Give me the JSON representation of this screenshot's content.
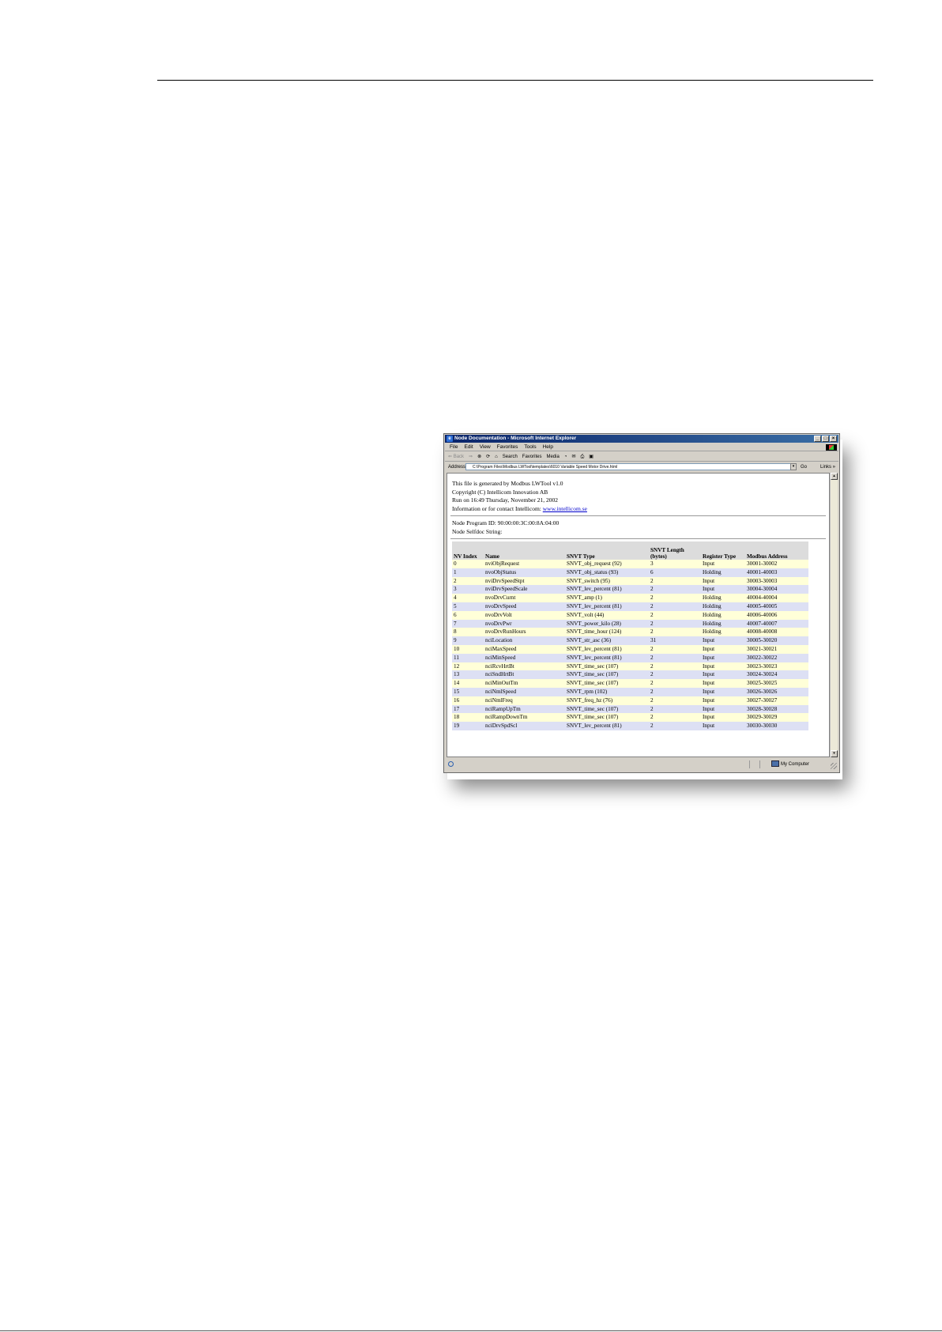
{
  "window": {
    "title": "Node Documentation - Microsoft Internet Explorer",
    "controls": [
      "_",
      "□",
      "×"
    ]
  },
  "menu": [
    "File",
    "Edit",
    "View",
    "Favorites",
    "Tools",
    "Help"
  ],
  "toolbar": {
    "back": "⇐ Back",
    "forward": "⇒",
    "stop": "⊗",
    "refresh": "⟳",
    "home": "⌂",
    "search": "Search",
    "favorites": "Favorites",
    "media": "Media",
    "history": "◔",
    "mail": "✉",
    "print": "⎙",
    "edit": "▣"
  },
  "address": {
    "label": "Address",
    "value": "C:\\Program Files\\Modbus LWTool\\templates\\6010 Variable Speed Motor Drive.html",
    "go": "Go",
    "links": "Links »"
  },
  "info": {
    "line1": "This file is generated by Modbus LWTool v1.0",
    "line2": "Copyright (C) Intellicom Innovation AB",
    "line3": "Run on 16:49 Thursday, November 21, 2002",
    "line4_prefix": "Information or for contact Intellicom: ",
    "link": "www.intellicom.se"
  },
  "node": {
    "program_id": "Node Program ID: 90:00:00:3C:00:8A:04:00",
    "selfdoc": "Node Selfdoc String:"
  },
  "table": {
    "headers": {
      "index": "NV Index",
      "name": "Name",
      "type": "SNVT Type",
      "length": "SNVT Length (bytes)",
      "register": "Register Type",
      "address": "Modbus Address"
    },
    "rows": [
      {
        "idx": "0",
        "name": "nviObjRequest",
        "type": "SNVT_obj_request (92)",
        "len": "3",
        "reg": "Input",
        "addr": "30001-30002"
      },
      {
        "idx": "1",
        "name": "nvoObjStatus",
        "type": "SNVT_obj_status (93)",
        "len": "6",
        "reg": "Holding",
        "addr": "40001-40003"
      },
      {
        "idx": "2",
        "name": "nviDrvSpeedStpt",
        "type": "SNVT_switch (95)",
        "len": "2",
        "reg": "Input",
        "addr": "30003-30003"
      },
      {
        "idx": "3",
        "name": "nviDrvSpeedScale",
        "type": "SNVT_lev_percent (81)",
        "len": "2",
        "reg": "Input",
        "addr": "30004-30004"
      },
      {
        "idx": "4",
        "name": "nvoDrvCurnt",
        "type": "SNVT_amp (1)",
        "len": "2",
        "reg": "Holding",
        "addr": "40004-40004"
      },
      {
        "idx": "5",
        "name": "nvoDrvSpeed",
        "type": "SNVT_lev_percent (81)",
        "len": "2",
        "reg": "Holding",
        "addr": "40005-40005"
      },
      {
        "idx": "6",
        "name": "nvoDrvVolt",
        "type": "SNVT_volt (44)",
        "len": "2",
        "reg": "Holding",
        "addr": "40006-40006"
      },
      {
        "idx": "7",
        "name": "nvoDrvPwr",
        "type": "SNVT_power_kilo (28)",
        "len": "2",
        "reg": "Holding",
        "addr": "40007-40007"
      },
      {
        "idx": "8",
        "name": "nvoDrvRunHours",
        "type": "SNVT_time_hour (124)",
        "len": "2",
        "reg": "Holding",
        "addr": "40008-40008"
      },
      {
        "idx": "9",
        "name": "nciLocation",
        "type": "SNVT_str_asc (36)",
        "len": "31",
        "reg": "Input",
        "addr": "30005-30020"
      },
      {
        "idx": "10",
        "name": "nciMaxSpeed",
        "type": "SNVT_lev_percent (81)",
        "len": "2",
        "reg": "Input",
        "addr": "30021-30021"
      },
      {
        "idx": "11",
        "name": "nciMinSpeed",
        "type": "SNVT_lev_percent (81)",
        "len": "2",
        "reg": "Input",
        "addr": "30022-30022"
      },
      {
        "idx": "12",
        "name": "nciRcvHrtBt",
        "type": "SNVT_time_sec (107)",
        "len": "2",
        "reg": "Input",
        "addr": "30023-30023"
      },
      {
        "idx": "13",
        "name": "nciSndHrtBt",
        "type": "SNVT_time_sec (107)",
        "len": "2",
        "reg": "Input",
        "addr": "30024-30024"
      },
      {
        "idx": "14",
        "name": "nciMinOutTm",
        "type": "SNVT_time_sec (107)",
        "len": "2",
        "reg": "Input",
        "addr": "30025-30025"
      },
      {
        "idx": "15",
        "name": "nciNmlSpeed",
        "type": "SNVT_rpm (102)",
        "len": "2",
        "reg": "Input",
        "addr": "30026-30026"
      },
      {
        "idx": "16",
        "name": "nciNmlFreq",
        "type": "SNVT_freq_hz (76)",
        "len": "2",
        "reg": "Input",
        "addr": "30027-30027"
      },
      {
        "idx": "17",
        "name": "nciRampUpTm",
        "type": "SNVT_time_sec (107)",
        "len": "2",
        "reg": "Input",
        "addr": "30028-30028"
      },
      {
        "idx": "18",
        "name": "nciRampDownTm",
        "type": "SNVT_time_sec (107)",
        "len": "2",
        "reg": "Input",
        "addr": "30029-30029"
      },
      {
        "idx": "19",
        "name": "nciDrvSpdScl",
        "type": "SNVT_lev_percent (81)",
        "len": "2",
        "reg": "Input",
        "addr": "30030-30030"
      }
    ]
  },
  "status": {
    "zone": "My Computer"
  }
}
